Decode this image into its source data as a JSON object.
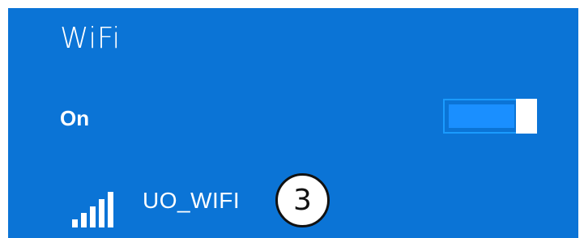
{
  "wifi_panel": {
    "title": "WiFi",
    "status_label": "On",
    "toggle_state": "on"
  },
  "network": {
    "name": "UO_WIFI",
    "signal_icon": "wifi-signal-bars-icon",
    "signal_bars": 5
  },
  "annotation": {
    "marker": "3"
  },
  "colors": {
    "panel_background": "#0b74d6",
    "toggle_fill": "#1a8fff",
    "toggle_border": "#1a9bff",
    "text": "#ffffff",
    "annotation_border": "#111111"
  }
}
